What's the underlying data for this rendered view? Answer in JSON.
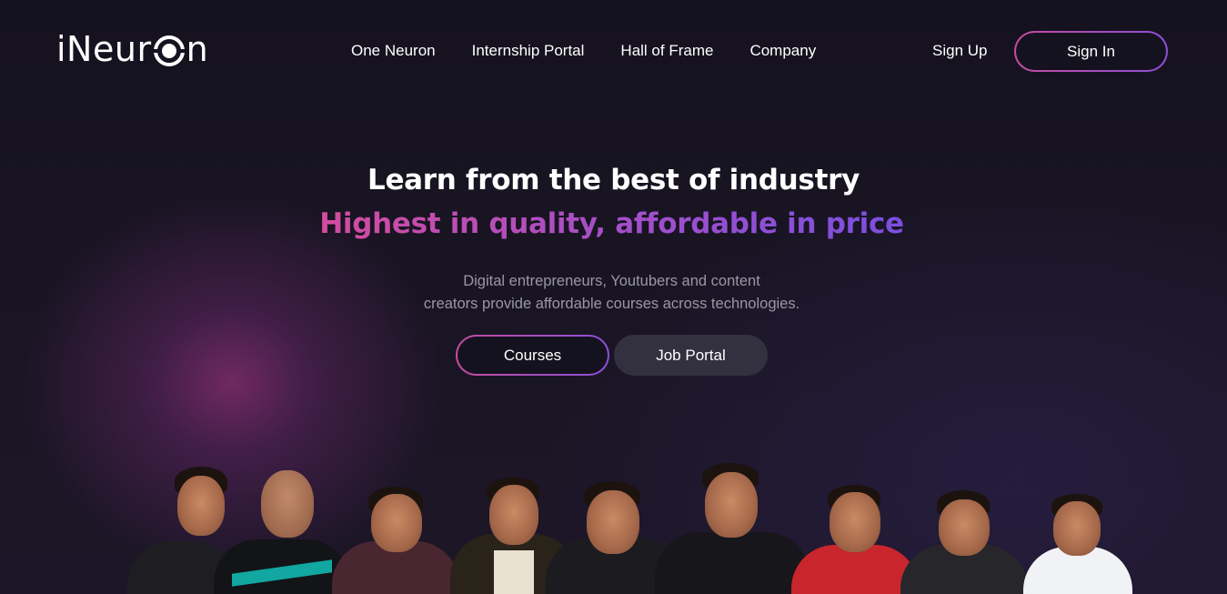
{
  "brand": {
    "logo_text_left": "iNeur",
    "logo_text_right": "n"
  },
  "nav": {
    "items": [
      {
        "label": "One Neuron"
      },
      {
        "label": "Internship Portal"
      },
      {
        "label": "Hall of Frame"
      },
      {
        "label": "Company"
      }
    ],
    "signup_label": "Sign Up",
    "signin_label": "Sign In"
  },
  "hero": {
    "headline": "Learn from the best of industry",
    "subheadline": "Highest in quality, affordable in price",
    "description_line1": "Digital entrepreneurs, Youtubers and content",
    "description_line2": "creators provide affordable courses across technologies.",
    "courses_label": "Courses",
    "job_portal_label": "Job Portal"
  },
  "colors": {
    "background": "#15121f",
    "accent_pink": "#c44ca0",
    "accent_purple": "#8b4fd8",
    "secondary_button": "#33303f"
  },
  "team_photo": {
    "people_count": 9
  }
}
